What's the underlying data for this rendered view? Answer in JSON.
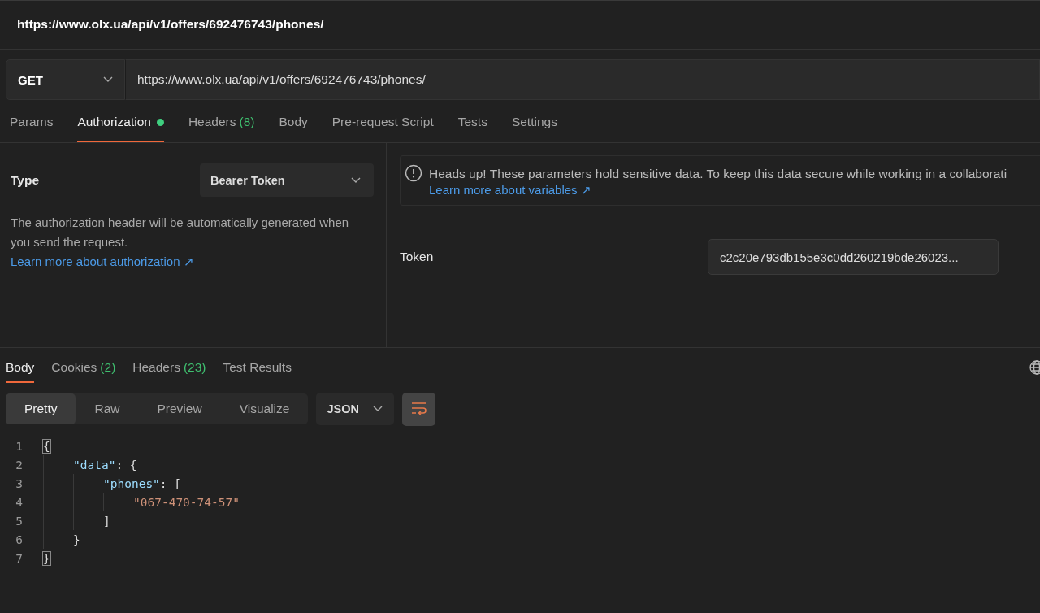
{
  "title": "https://www.olx.ua/api/v1/offers/692476743/phones/",
  "request": {
    "method": "GET",
    "url": "https://www.olx.ua/api/v1/offers/692476743/phones/"
  },
  "request_tabs": [
    {
      "label": "Params",
      "dot": false,
      "selected": false
    },
    {
      "label": "Authorization",
      "dot": true,
      "selected": true
    },
    {
      "label": "Headers",
      "count": "(8)",
      "dot": false,
      "selected": false
    },
    {
      "label": "Body",
      "dot": false,
      "selected": false
    },
    {
      "label": "Pre-request Script",
      "dot": false,
      "selected": false
    },
    {
      "label": "Tests",
      "dot": false,
      "selected": false
    },
    {
      "label": "Settings",
      "dot": false,
      "selected": false
    }
  ],
  "auth": {
    "type_label": "Type",
    "type_value": "Bearer Token",
    "description": "The authorization header will be automatically generated when you send the request.",
    "learn_link": "Learn more about authorization ↗",
    "notice": "Heads up! These parameters hold sensitive data. To keep this data secure while working in a collaborati",
    "notice_link": "Learn more about variables ↗",
    "token_label": "Token",
    "token_value": "c2c20e793db155e3c0dd260219bde26023..."
  },
  "response_tabs": [
    {
      "label": "Body",
      "selected": true
    },
    {
      "label": "Cookies",
      "count": "(2)",
      "selected": false
    },
    {
      "label": "Headers",
      "count": "(23)",
      "selected": false
    },
    {
      "label": "Test Results",
      "selected": false
    }
  ],
  "view_modes": [
    {
      "label": "Pretty",
      "selected": true
    },
    {
      "label": "Raw",
      "selected": false
    },
    {
      "label": "Preview",
      "selected": false
    },
    {
      "label": "Visualize",
      "selected": false
    }
  ],
  "format": "JSON",
  "wrap_on": true,
  "code_lines": [
    {
      "number": "1",
      "tokens": [
        {
          "kind": "punct",
          "text": "{"
        }
      ]
    },
    {
      "number": "2",
      "tokens": [
        {
          "kind": "key",
          "text": "\"data\""
        },
        {
          "kind": "punct",
          "text": ": {"
        }
      ]
    },
    {
      "number": "3",
      "tokens": [
        {
          "kind": "key",
          "text": "\"phones\""
        },
        {
          "kind": "punct",
          "text": ": ["
        }
      ]
    },
    {
      "number": "4",
      "tokens": [
        {
          "kind": "string",
          "text": "\"067-470-74-57\""
        }
      ]
    },
    {
      "number": "5",
      "tokens": [
        {
          "kind": "punct",
          "text": "]"
        }
      ]
    },
    {
      "number": "6",
      "tokens": [
        {
          "kind": "punct",
          "text": "}"
        }
      ]
    },
    {
      "number": "7",
      "tokens": [
        {
          "kind": "punct",
          "text": "}"
        }
      ]
    }
  ]
}
